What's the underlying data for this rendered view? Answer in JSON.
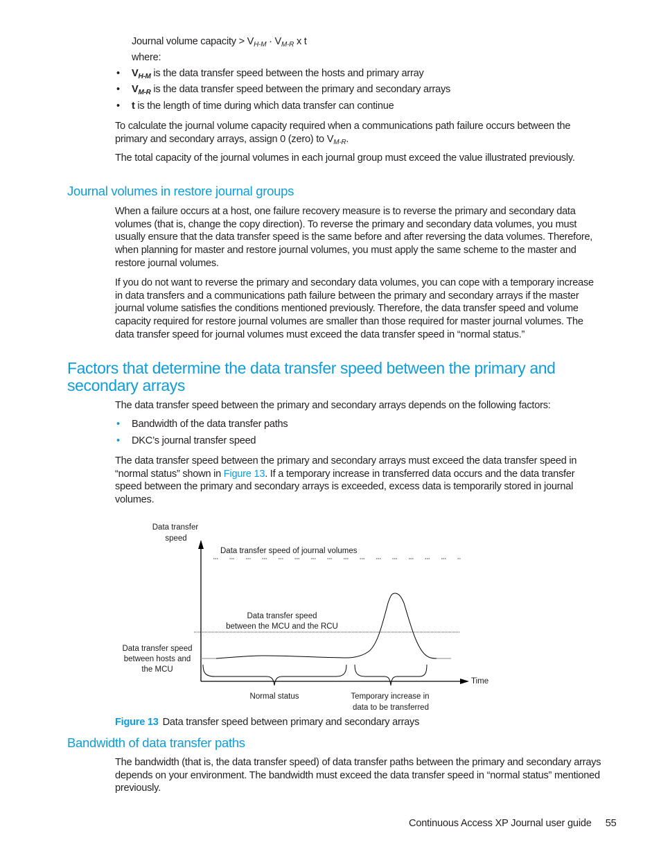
{
  "formula": {
    "prefix": "Journal volume capacity > V",
    "sub1": "H-M",
    "mid": " · V",
    "sub2": "M-R",
    "suffix": " x t",
    "where": "where:"
  },
  "definitions": [
    {
      "symbol": "V",
      "sub": "H-M",
      "text": " is the data transfer speed between the hosts and primary array"
    },
    {
      "symbol": "V",
      "sub": "M-R",
      "text": " is the data transfer speed between the primary and secondary arrays"
    },
    {
      "symbol": "t",
      "sub": "",
      "text": " is the length of time during which data transfer can continue"
    }
  ],
  "para_calc": {
    "text": "To calculate the journal volume capacity required when a communications path failure occurs between the primary and secondary arrays, assign 0 (zero) to V",
    "sub": "M-R",
    "end": "."
  },
  "para_total": "The total capacity of the journal volumes in each journal group must exceed the value illustrated previously.",
  "section_restore": {
    "heading": "Journal volumes in restore journal groups",
    "para1": "When a failure occurs at a host, one failure recovery measure is to reverse the primary and secondary data volumes (that is, change the copy direction). To reverse the primary and secondary data volumes, you must usually ensure that the data transfer speed is the same before and after reversing the data volumes. Therefore, when planning for master and restore journal volumes, you must apply the same scheme to the master and restore journal volumes.",
    "para2": "If you do not want to reverse the primary and secondary data volumes, you can cope with a temporary increase in data transfers and a communications path failure between the primary and secondary arrays if the master journal volume satisfies the conditions mentioned previously. Therefore, the data transfer speed and volume capacity required for restore journal volumes are smaller than those required for master journal volumes. The data transfer speed for journal volumes must exceed the data transfer speed in “normal status.”"
  },
  "section_factors": {
    "heading": "Factors that determine the data transfer speed between the primary and secondary arrays",
    "intro": "The data transfer speed between the primary and secondary arrays depends on the following factors:",
    "bullets": [
      "Bandwidth of the data transfer paths",
      "DKC’s journal transfer speed"
    ],
    "para_before_link": "The data transfer speed between the primary and secondary arrays must exceed the data transfer speed in “normal status” shown in ",
    "link": "Figure 13",
    "para_after_link": ". If a temporary increase in transferred data occurs and the data transfer speed between the primary and secondary arrays is exceeded, excess data is temporarily stored in journal volumes."
  },
  "figure": {
    "label": "Figure 13",
    "caption": "Data transfer speed between primary and secondary arrays",
    "y_axis_label_line1": "Data transfer",
    "y_axis_label_line2": "speed",
    "x_axis_label": "Time",
    "journal_line_label": "Data transfer speed of journal volumes",
    "mcu_rcu_label_line1": "Data transfer speed",
    "mcu_rcu_label_line2": "between the MCU and the RCU",
    "host_label_line1": "Data transfer speed",
    "host_label_line2": "between hosts and",
    "host_label_line3": "the MCU",
    "normal_label": "Normal status",
    "temp_label_line1": "Temporary increase in",
    "temp_label_line2": "data to be transferred"
  },
  "section_bandwidth": {
    "heading": "Bandwidth of data transfer paths",
    "para": "The bandwidth (that is, the data transfer speed) of data transfer paths between the primary and secondary arrays depends on your environment. The bandwidth must exceed the data transfer speed in “normal status” mentioned previously."
  },
  "footer": {
    "title": "Continuous Access XP Journal user guide",
    "page": "55"
  }
}
